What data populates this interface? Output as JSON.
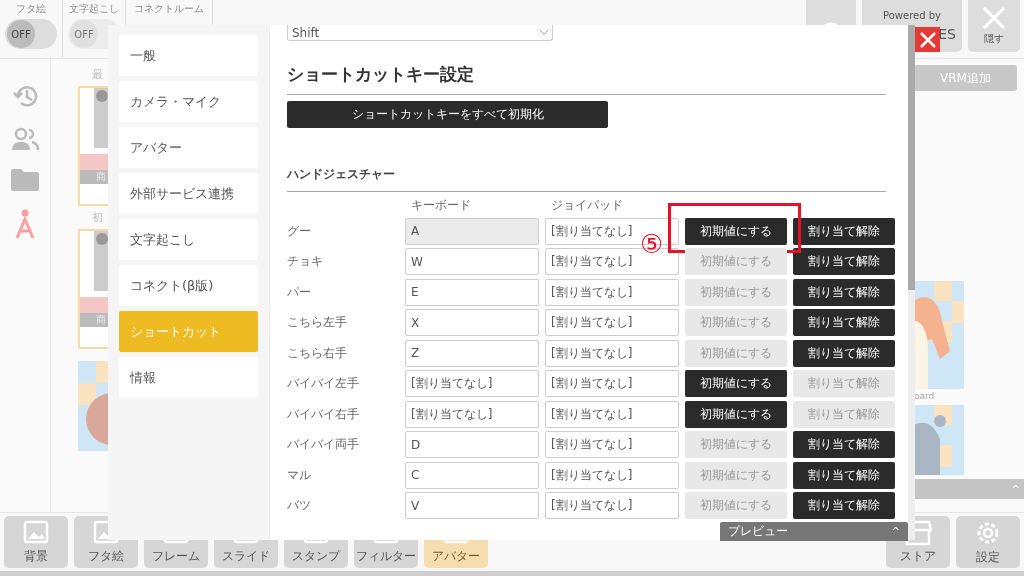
{
  "top_bar": {
    "toggles": [
      {
        "label": "フタ絵",
        "value": "OFF",
        "on": false,
        "disabled": false
      },
      {
        "label": "文字起こし",
        "value": "OFF",
        "on": false,
        "disabled": true
      }
    ],
    "tab": "コネクトルーム",
    "powered_by": "Powered by",
    "logo_fragment": "ES",
    "hide_button": "隠す"
  },
  "vrm_button": "VRM追加",
  "library": {
    "sections": [
      {
        "label": "最",
        "thumb_caption": "商"
      },
      {
        "label": "初",
        "thumb_caption": "商"
      }
    ],
    "card_caption": "oard"
  },
  "bottom_toolbar": [
    {
      "label": "背景",
      "selected": false
    },
    {
      "label": "フタ絵",
      "selected": false
    },
    {
      "label": "フレーム",
      "selected": false
    },
    {
      "label": "スライド",
      "selected": false
    },
    {
      "label": "スタンプ",
      "selected": false
    },
    {
      "label": "フィルター",
      "selected": false
    },
    {
      "label": "アバター",
      "selected": true
    }
  ],
  "right_toolbar": [
    {
      "label": "ストア",
      "kind": "store"
    },
    {
      "label": "設定",
      "kind": "settings"
    }
  ],
  "settings": {
    "nav": [
      {
        "label": "一般",
        "selected": false
      },
      {
        "label": "カメラ・マイク",
        "selected": false
      },
      {
        "label": "アバター",
        "selected": false
      },
      {
        "label": "外部サービス連携",
        "selected": false
      },
      {
        "label": "文字起こし",
        "selected": false
      },
      {
        "label": "コネクト(β版)",
        "selected": false
      },
      {
        "label": "ショートカット",
        "selected": true
      },
      {
        "label": "情報",
        "selected": false
      }
    ],
    "select_value": "Shift",
    "heading": "ショートカットキー設定",
    "reset_all_button": "ショートカットキーをすべて初期化",
    "section": "ハンドジェスチャー",
    "columns": [
      "キーボード",
      "ジョイパッド"
    ],
    "rows": [
      {
        "label": "グー",
        "keyboard": "A",
        "keyboard_focused": true,
        "joypad": "[割り当てなし]",
        "reset": "初期値にする",
        "reset_enabled": true,
        "clear": "割り当て解除",
        "clear_enabled": true,
        "highlighted": true
      },
      {
        "label": "チョキ",
        "keyboard": "W",
        "keyboard_focused": false,
        "joypad": "[割り当てなし]",
        "reset": "初期値にする",
        "reset_enabled": false,
        "clear": "割り当て解除",
        "clear_enabled": true,
        "highlighted": false
      },
      {
        "label": "パー",
        "keyboard": "E",
        "keyboard_focused": false,
        "joypad": "[割り当てなし]",
        "reset": "初期値にする",
        "reset_enabled": false,
        "clear": "割り当て解除",
        "clear_enabled": true,
        "highlighted": false
      },
      {
        "label": "こちら左手",
        "keyboard": "X",
        "keyboard_focused": false,
        "joypad": "[割り当てなし]",
        "reset": "初期値にする",
        "reset_enabled": false,
        "clear": "割り当て解除",
        "clear_enabled": true,
        "highlighted": false
      },
      {
        "label": "こちら右手",
        "keyboard": "Z",
        "keyboard_focused": false,
        "joypad": "[割り当てなし]",
        "reset": "初期値にする",
        "reset_enabled": false,
        "clear": "割り当て解除",
        "clear_enabled": true,
        "highlighted": false
      },
      {
        "label": "バイバイ左手",
        "keyboard": "[割り当てなし]",
        "keyboard_focused": false,
        "joypad": "[割り当てなし]",
        "reset": "初期値にする",
        "reset_enabled": true,
        "clear": "割り当て解除",
        "clear_enabled": false,
        "highlighted": false
      },
      {
        "label": "バイバイ右手",
        "keyboard": "[割り当てなし]",
        "keyboard_focused": false,
        "joypad": "[割り当てなし]",
        "reset": "初期値にする",
        "reset_enabled": true,
        "clear": "割り当て解除",
        "clear_enabled": false,
        "highlighted": false
      },
      {
        "label": "バイバイ両手",
        "keyboard": "D",
        "keyboard_focused": false,
        "joypad": "[割り当てなし]",
        "reset": "初期値にする",
        "reset_enabled": false,
        "clear": "割り当て解除",
        "clear_enabled": true,
        "highlighted": false
      },
      {
        "label": "マル",
        "keyboard": "C",
        "keyboard_focused": false,
        "joypad": "[割り当てなし]",
        "reset": "初期値にする",
        "reset_enabled": false,
        "clear": "割り当て解除",
        "clear_enabled": true,
        "highlighted": false
      },
      {
        "label": "バツ",
        "keyboard": "V",
        "keyboard_focused": false,
        "joypad": "[割り当てなし]",
        "reset": "初期値にする",
        "reset_enabled": false,
        "clear": "割り当て解除",
        "clear_enabled": true,
        "highlighted": false
      }
    ],
    "annotation": "⑤"
  },
  "preview_bar": {
    "label": "プレビュー",
    "caret": "^"
  }
}
